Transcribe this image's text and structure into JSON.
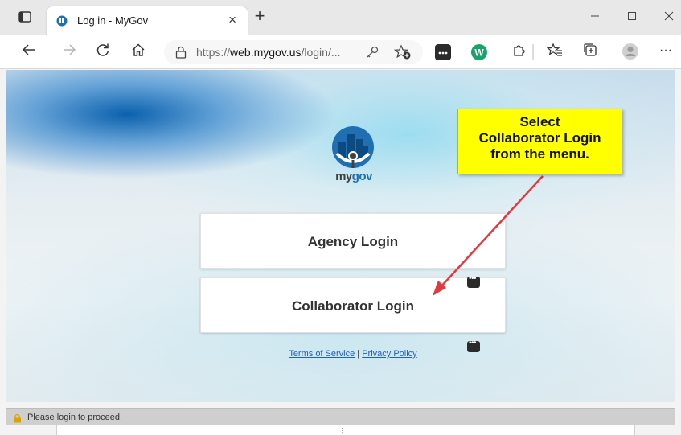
{
  "browser": {
    "tab": {
      "title": "Log in - MyGov",
      "close_glyph": "×"
    },
    "new_tab_glyph": "+",
    "window_controls": {
      "minimize": "—",
      "maximize": "☐",
      "close": "✕"
    },
    "address": {
      "prefix": "https://",
      "host": "web.mygov.us",
      "path": "/login/..."
    },
    "toolbar_icons": [
      "back-arrow-icon",
      "forward-arrow-icon",
      "refresh-icon",
      "home-icon",
      "key-icon",
      "favorites-add-icon",
      "password-manager-extension-icon",
      "grammarly-icon",
      "extensions-icon",
      "favorites-icon",
      "collections-icon",
      "profile-avatar-icon",
      "more-menu-icon"
    ],
    "more_glyph": "···"
  },
  "page": {
    "logo": {
      "text_my": "my",
      "text_gov": "gov",
      "colors": {
        "primary": "#1f6fb2",
        "dark": "#404040"
      }
    },
    "buttons": [
      {
        "label": "Agency Login"
      },
      {
        "label": "Collaborator Login"
      }
    ],
    "footer": {
      "terms": "Terms of Service",
      "separator": "|",
      "privacy": "Privacy Policy"
    }
  },
  "annotation": {
    "callout_lines": [
      "Select",
      "Collaborator Login",
      "from the menu."
    ],
    "callout_color": "#ffff00",
    "arrow_color": "#e0393e"
  },
  "statusbar": {
    "text": "Please login to proceed."
  }
}
